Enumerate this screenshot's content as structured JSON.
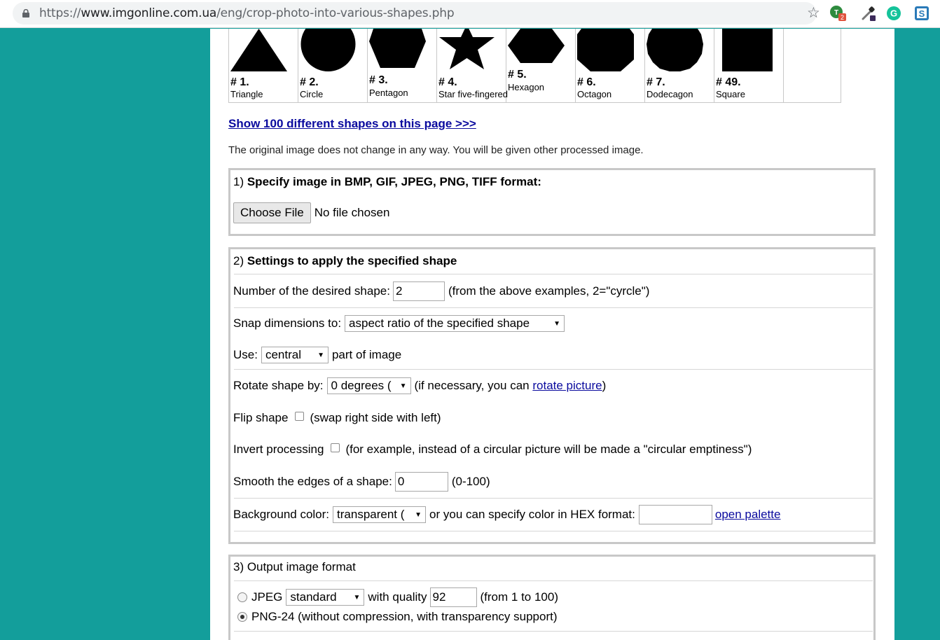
{
  "browser": {
    "url_prefix": "https://",
    "url_host": "www.imgonline.com.ua",
    "url_path": "/eng/crop-photo-into-various-shapes.php",
    "extension_badge": "2"
  },
  "shapes": [
    {
      "num": "# 1.",
      "name": "Triangle"
    },
    {
      "num": "# 2.",
      "name": "Circle"
    },
    {
      "num": "# 3.",
      "name": "Pentagon"
    },
    {
      "num": "# 4.",
      "name": "Star five-fingered"
    },
    {
      "num": "# 5.",
      "name": "Hexagon"
    },
    {
      "num": "# 6.",
      "name": "Octagon"
    },
    {
      "num": "# 7.",
      "name": "Dodecagon"
    },
    {
      "num": "# 49.",
      "name": "Square"
    }
  ],
  "show_link": "Show 100 different shapes on this page >>>",
  "notice": "The original image does not change in any way. You will be given other processed image.",
  "section1": {
    "prefix": "1) ",
    "title": "Specify image in BMP, GIF, JPEG, PNG, TIFF format:",
    "choose_button": "Choose File",
    "file_status": "No file chosen"
  },
  "section2": {
    "prefix": "2) ",
    "title": "Settings to apply the specified shape",
    "shape_number_label": "Number of the desired shape:",
    "shape_number_value": "2",
    "shape_number_hint": "(from the above examples, 2=\"cyrcle\")",
    "snap_label": "Snap dimensions to:",
    "snap_value": "aspect ratio of the specified shape",
    "use_label": "Use:",
    "use_value": "central",
    "use_suffix": "part of image",
    "rotate_label": "Rotate shape by:",
    "rotate_value": "0 degrees (",
    "rotate_hint_pre": "(if necessary, you can ",
    "rotate_link": "rotate picture",
    "rotate_hint_post": ")",
    "flip_label": "Flip shape",
    "flip_hint": "(swap right side with left)",
    "invert_label": "Invert processing",
    "invert_hint": "(for example, instead of a circular picture will be made a \"circular emptiness\")",
    "smooth_label": "Smooth the edges of a shape:",
    "smooth_value": "0",
    "smooth_hint": "(0-100)",
    "bg_label": "Background color:",
    "bg_value": "transparent (",
    "bg_hint": "or you can specify color in HEX format:",
    "bg_hex_value": "",
    "palette_link": "open palette"
  },
  "section3": {
    "title": "3) Output image format",
    "jpeg_label": "JPEG",
    "jpeg_mode": "standard",
    "quality_label": "with quality",
    "quality_value": "92",
    "quality_hint": "(from 1 to 100)",
    "png_label": "PNG-24 (without compression, with transparency support)"
  },
  "colors": {
    "page_background": "#139e9b",
    "link": "#0a0a9e"
  }
}
